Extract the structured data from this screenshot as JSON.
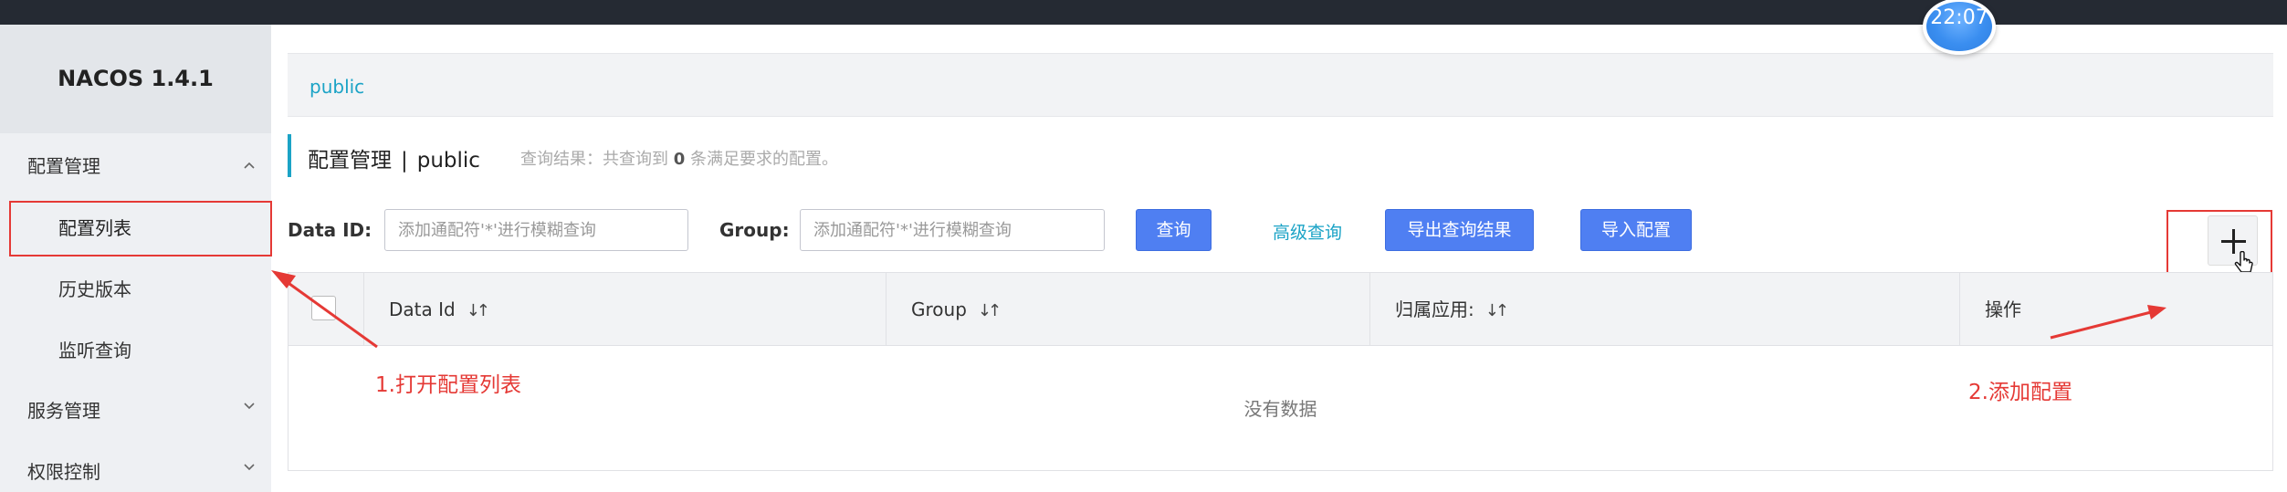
{
  "clock": {
    "time": "22:07"
  },
  "sidebar": {
    "brand": "NACOS 1.4.1",
    "groups": [
      {
        "label": "配置管理",
        "expanded": true,
        "items": [
          {
            "label": "配置列表",
            "active": true
          },
          {
            "label": "历史版本"
          },
          {
            "label": "监听查询"
          }
        ]
      },
      {
        "label": "服务管理",
        "expanded": false
      },
      {
        "label": "权限控制",
        "expanded": false
      }
    ]
  },
  "breadcrumb": {
    "namespace": "public"
  },
  "page": {
    "title": "配置管理",
    "separator": "|",
    "namespace": "public",
    "result_prefix": "查询结果：共查询到",
    "result_count": "0",
    "result_suffix": "条满足要求的配置。"
  },
  "search": {
    "data_id_label": "Data ID:",
    "data_id_placeholder": "添加通配符'*'进行模糊查询",
    "group_label": "Group:",
    "group_placeholder": "添加通配符'*'进行模糊查询",
    "query_button": "查询",
    "advanced_link": "高级查询",
    "export_button": "导出查询结果",
    "import_button": "导入配置"
  },
  "table": {
    "columns": [
      "Data Id",
      "Group",
      "归属应用:",
      "操作"
    ],
    "empty_text": "没有数据"
  },
  "annotations": {
    "step1": "1.打开配置列表",
    "step2": "2.添加配置",
    "color": "#e53935"
  },
  "colors": {
    "accent": "#1ba3c6",
    "primary_button": "#4f7ff2",
    "topbar": "#252a33"
  }
}
